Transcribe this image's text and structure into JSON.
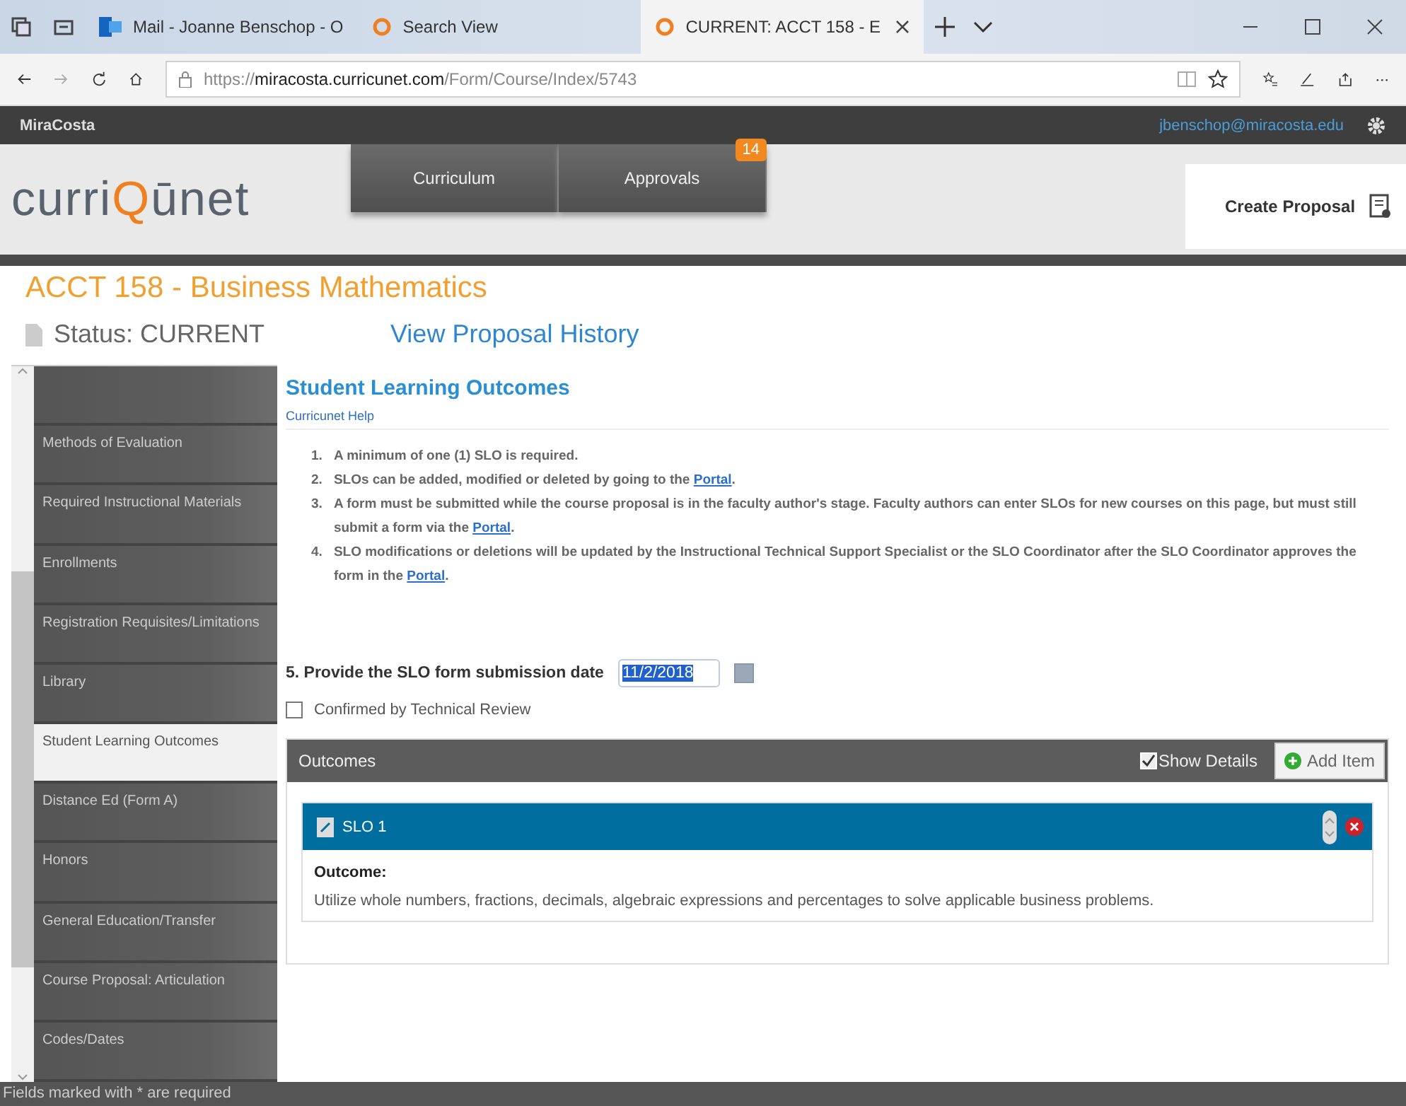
{
  "browser": {
    "tabs": [
      {
        "label": "Mail - Joanne Benschop - O",
        "selected": false
      },
      {
        "label": "Search View",
        "selected": false
      },
      {
        "label": "CURRENT: ACCT 158 - E",
        "selected": true
      }
    ],
    "url": "https://**miracosta.curricunet.com**/Form/Course/Index/5743"
  },
  "top_bar": {
    "institution": "MiraCosta",
    "user_email": "jbenschop@miracosta.edu"
  },
  "header": {
    "logo": [
      {
        "text": "curri",
        "accent": false
      },
      {
        "text": "Q",
        "accent": true
      },
      {
        "text": "ūnet",
        "accent": false
      }
    ],
    "nav": [
      {
        "label": "Curriculum"
      },
      {
        "label": "Approvals",
        "badge": "14"
      }
    ],
    "create_button": "Create Proposal"
  },
  "course": {
    "title": "ACCT 158 - Business Mathematics",
    "status": "Status: CURRENT",
    "history_link": "View Proposal History"
  },
  "sidebar": {
    "items": [
      {
        "selected": false
      },
      {
        "label": "Methods of Evaluation",
        "selected": false
      },
      {
        "label": "Required Instructional Materials",
        "selected": false
      },
      {
        "label": "Enrollments",
        "selected": false
      },
      {
        "label": "Registration Requisites/Limitations",
        "selected": false
      },
      {
        "label": "Library",
        "selected": false
      },
      {
        "label": "Student Learning Outcomes",
        "selected": true
      },
      {
        "label": "Distance Ed (Form A)",
        "selected": false
      },
      {
        "label": "Honors",
        "selected": false
      },
      {
        "label": "General Education/Transfer",
        "selected": false
      },
      {
        "label": "Course Proposal: Articulation",
        "selected": false
      },
      {
        "label": "Codes/Dates",
        "selected": false
      }
    ]
  },
  "section": {
    "title": "Student Learning Outcomes",
    "help_link": "Curricunet Help",
    "rules": [
      {
        "number": "1.",
        "text": "A minimum of one (1) SLO is required."
      },
      {
        "number": "2.",
        "text": "SLOs can be added, modified or deleted by going to the ",
        "link": "Portal",
        "after": "."
      },
      {
        "number": "3.",
        "text": "A form must be submitted while the course proposal is in the faculty author's stage. Faculty authors can enter SLOs for new courses on this page, but must still submit a form via the ",
        "link": "Portal",
        "after": "."
      },
      {
        "number": "4.",
        "text": "SLO modifications or deletions will be updated by the Instructional Technical Support Specialist or the SLO Coordinator after the SLO Coordinator approves the form in the ",
        "link": "Portal",
        "after": "."
      }
    ],
    "date_label": "5. Provide the SLO form submission date",
    "date_value": "11/2/2018",
    "confirm": {
      "label": "Confirmed by Technical Review",
      "checked": false
    },
    "outcomes": {
      "title": "Outcomes",
      "show_details": {
        "label": "Show Details",
        "checked": true
      },
      "add_button": "Add Item",
      "items": [
        {
          "title": "SLO 1",
          "field_label": "Outcome:",
          "text": "Utilize whole numbers, fractions, decimals, algebraic expressions and percentages to solve applicable business problems."
        }
      ]
    }
  },
  "footer": {
    "note": "Fields marked with * are required"
  }
}
